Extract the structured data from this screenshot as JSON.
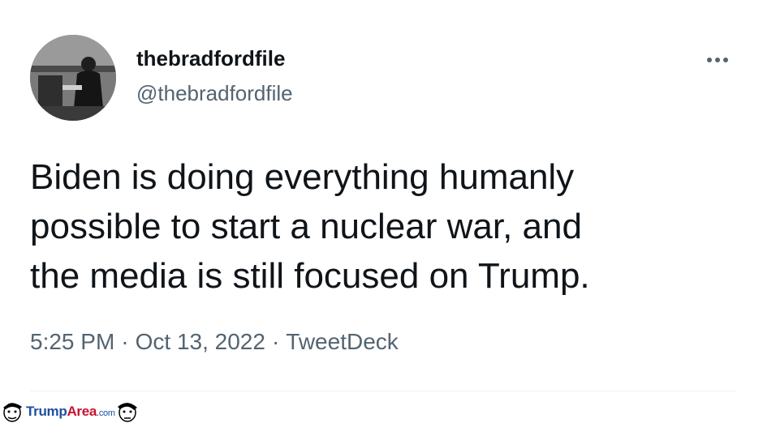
{
  "tweet": {
    "display_name": "thebradfordfile",
    "handle": "@thebradfordfile",
    "text": "Biden is doing everything humanly\npossible to start a nuclear war, and\nthe media is still focused on Trump.",
    "time": "5:25 PM",
    "date": "Oct 13, 2022",
    "source": "TweetDeck",
    "separator": "·"
  },
  "watermark": {
    "part1": "Trump",
    "part2": "Area",
    "part3": ".com"
  },
  "colors": {
    "text_primary": "#0f1419",
    "text_secondary": "#536471",
    "divider": "#eff3f4",
    "watermark_blue": "#1d4fa3",
    "watermark_red": "#c8102e"
  },
  "icons": {
    "more": "more-horizontal-icon",
    "watermark_face": "caricature-face-icon"
  }
}
